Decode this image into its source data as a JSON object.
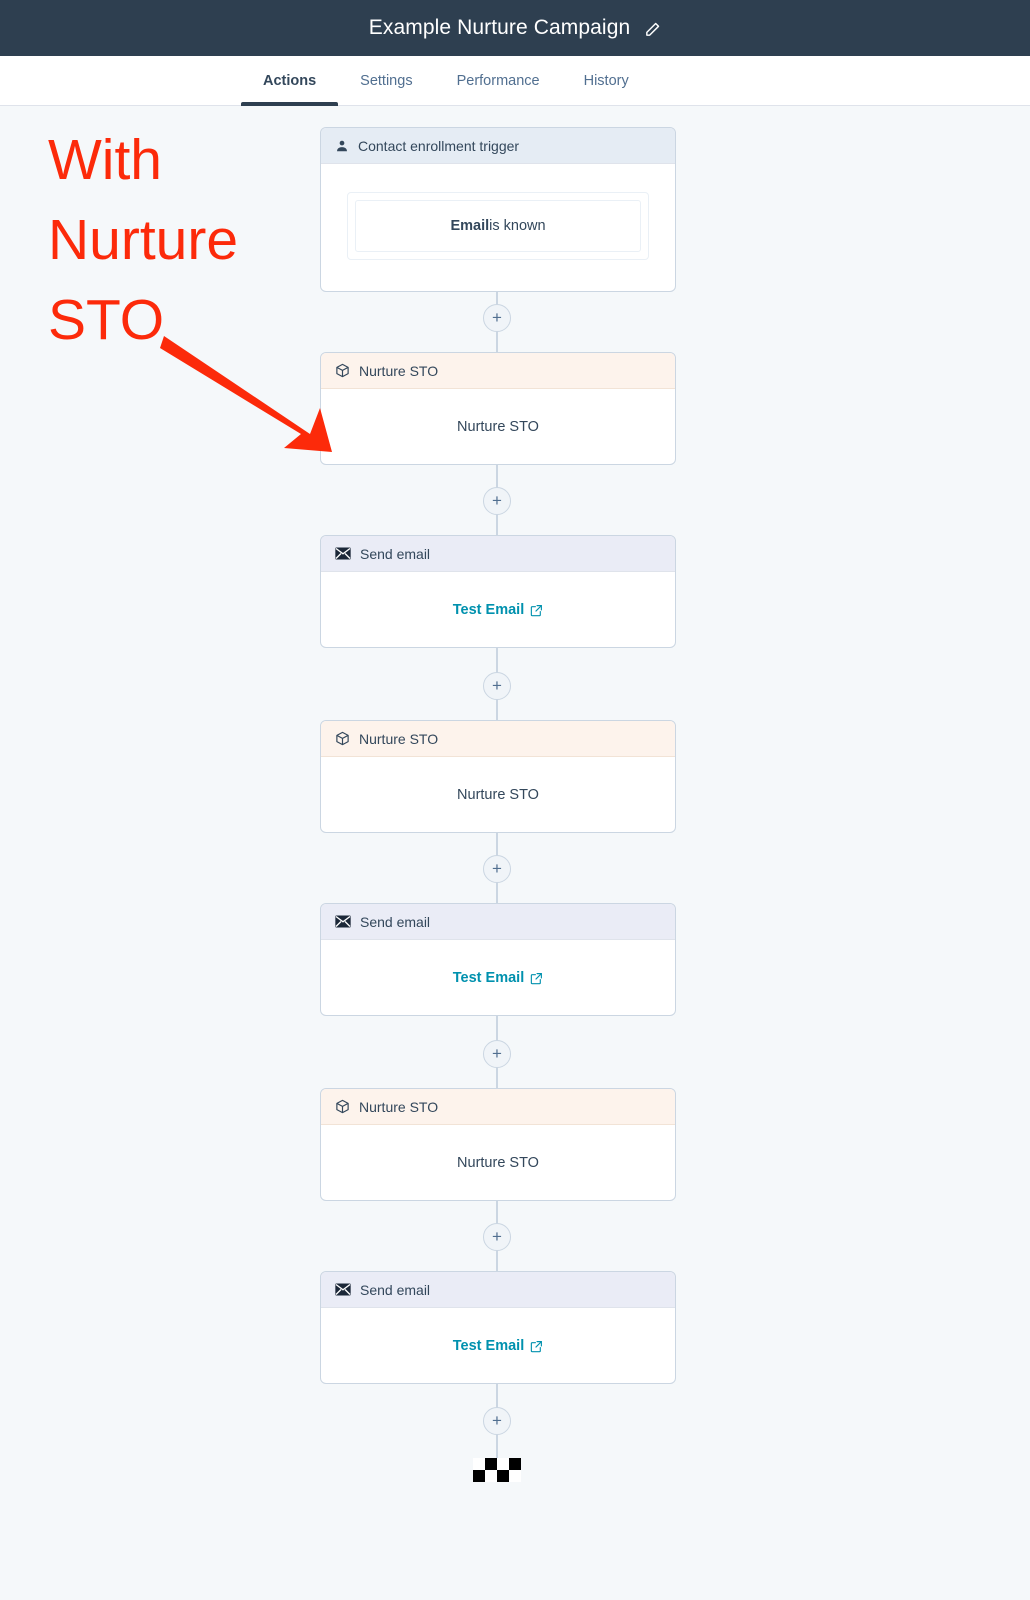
{
  "titlebar": {
    "title": "Example Nurture Campaign",
    "edit_icon": "pencil-icon"
  },
  "tabs": [
    {
      "label": "Actions",
      "active": true
    },
    {
      "label": "Settings",
      "active": false
    },
    {
      "label": "Performance",
      "active": false
    },
    {
      "label": "History",
      "active": false
    }
  ],
  "annotation": {
    "text": "With\nNurture\nSTO",
    "color": "#fc2a0a",
    "arrow": "arrow-down-right-icon"
  },
  "colors": {
    "titlebar_bg": "#2e3f50",
    "canvas_bg": "#f5f8fa",
    "connector": "#cbd6e2",
    "trigger_header_bg": "#e5ecf4",
    "sto_header_bg": "#fdf3ec",
    "email_header_bg": "#eaecf6",
    "link": "#0091ae",
    "annotation_red": "#fc2a0a"
  },
  "workflow": {
    "plus_label": "+",
    "end_flag": "checkered-flag-icon",
    "nodes": [
      {
        "type": "trigger",
        "icon": "contact-person-icon",
        "header": "Contact enrollment trigger",
        "condition_property": "Email",
        "condition_operator": " is known"
      },
      {
        "type": "sto",
        "icon": "cube-icon",
        "header": "Nurture STO",
        "body": "Nurture STO"
      },
      {
        "type": "email",
        "icon": "envelope-icon",
        "header": "Send email",
        "body": "Test Email",
        "body_icon": "external-link-icon"
      },
      {
        "type": "sto",
        "icon": "cube-icon",
        "header": "Nurture STO",
        "body": "Nurture STO"
      },
      {
        "type": "email",
        "icon": "envelope-icon",
        "header": "Send email",
        "body": "Test Email",
        "body_icon": "external-link-icon"
      },
      {
        "type": "sto",
        "icon": "cube-icon",
        "header": "Nurture STO",
        "body": "Nurture STO"
      },
      {
        "type": "email",
        "icon": "envelope-icon",
        "header": "Send email",
        "body": "Test Email",
        "body_icon": "external-link-icon"
      }
    ]
  }
}
